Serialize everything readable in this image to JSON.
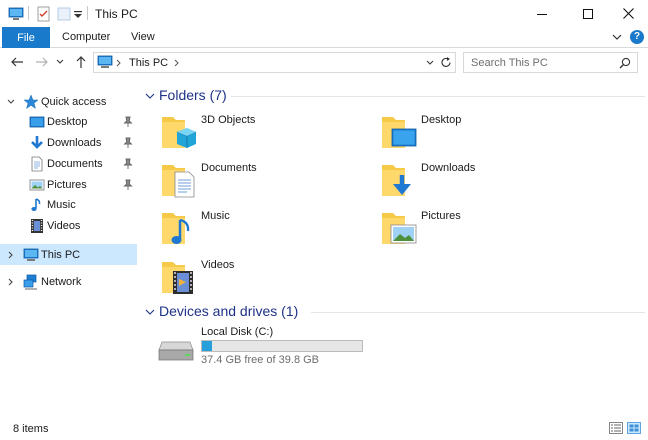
{
  "window": {
    "title": "This PC",
    "minimize_icon": "minimize-icon",
    "maximize_icon": "maximize-icon",
    "close_icon": "close-icon"
  },
  "ribbon": {
    "tabs": [
      {
        "label": "File",
        "active": true
      },
      {
        "label": "Computer"
      },
      {
        "label": "View"
      }
    ],
    "help_label": "?"
  },
  "address": {
    "crumbs": [
      "This PC"
    ],
    "search_placeholder": "Search This PC"
  },
  "nav": {
    "quick_access": {
      "label": "Quick access",
      "items": [
        {
          "label": "Desktop",
          "pinned": true
        },
        {
          "label": "Downloads",
          "pinned": true
        },
        {
          "label": "Documents",
          "pinned": true
        },
        {
          "label": "Pictures",
          "pinned": true
        },
        {
          "label": "Music",
          "pinned": false
        },
        {
          "label": "Videos",
          "pinned": false
        }
      ]
    },
    "this_pc": {
      "label": "This PC",
      "selected": true
    },
    "network": {
      "label": "Network"
    }
  },
  "content": {
    "folders_header": "Folders (7)",
    "folders": [
      {
        "label": "3D Objects",
        "icon": "3d-objects-folder-icon"
      },
      {
        "label": "Desktop",
        "icon": "desktop-folder-icon"
      },
      {
        "label": "Documents",
        "icon": "documents-folder-icon"
      },
      {
        "label": "Downloads",
        "icon": "downloads-folder-icon"
      },
      {
        "label": "Music",
        "icon": "music-folder-icon"
      },
      {
        "label": "Pictures",
        "icon": "pictures-folder-icon"
      },
      {
        "label": "Videos",
        "icon": "videos-folder-icon"
      }
    ],
    "drives_header": "Devices and drives (1)",
    "drives": [
      {
        "name": "Local Disk (C:)",
        "free": "37.4 GB free of 39.8 GB",
        "used_fraction": 0.06
      }
    ]
  },
  "status": {
    "items_text": "8 items"
  },
  "colors": {
    "accent": "#1979ca",
    "selection": "#cce8ff",
    "group_title": "#1e3287",
    "drive_fill": "#26a0da",
    "folder_yellow": "#ffd86b"
  }
}
